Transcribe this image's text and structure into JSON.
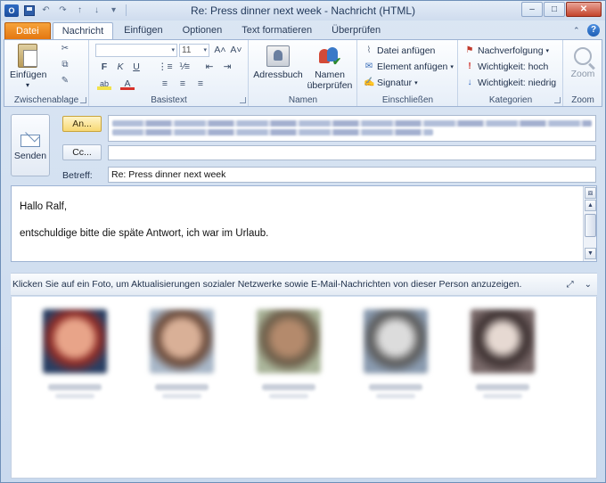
{
  "window": {
    "title": "Re: Press dinner next week - Nachricht (HTML)",
    "app_icon_letter": "O",
    "controls": {
      "minimize": "–",
      "maximize": "□",
      "close": "✕"
    }
  },
  "quick_access": {
    "undo": "↶",
    "redo": "↷",
    "up": "↑",
    "down": "↓",
    "customize": "▾"
  },
  "tabs": [
    {
      "label": "Datei"
    },
    {
      "label": "Nachricht"
    },
    {
      "label": "Einfügen"
    },
    {
      "label": "Optionen"
    },
    {
      "label": "Text formatieren"
    },
    {
      "label": "Überprüfen"
    }
  ],
  "help": {
    "caret": "⌃",
    "help": "?"
  },
  "ribbon": {
    "clipboard": {
      "label": "Zwischenablage",
      "paste": "Einfügen",
      "paste_arrow": "▾",
      "cut_icon": "✂",
      "copy_icon": "⧉",
      "painter_icon": "✎"
    },
    "basictext": {
      "label": "Basistext",
      "font_value": "",
      "size_value": "11",
      "grow": "A˄",
      "shrink": "A˅",
      "bold": "F",
      "italic": "K",
      "underline": "U",
      "highlight": "ab",
      "fontcolor": "A",
      "dd": "▾"
    },
    "names": {
      "label": "Namen",
      "address_book": "Adressbuch",
      "check_names_1": "Namen",
      "check_names_2": "überprüfen"
    },
    "include": {
      "label": "Einschließen",
      "attach_file": "Datei anfügen",
      "attach_item": "Element anfügen",
      "signature": "Signatur"
    },
    "tags": {
      "label": "Kategorien",
      "followup": "Nachverfolgung",
      "high": "Wichtigkeit: hoch",
      "low": "Wichtigkeit: niedrig"
    },
    "zoom": {
      "label": "Zoom",
      "button": "Zoom"
    }
  },
  "compose": {
    "send": "Senden",
    "to_button": "An...",
    "cc_button": "Cc...",
    "subject_label": "Betreff:",
    "subject_value": "Re: Press dinner next week"
  },
  "body": {
    "greeting": "Hallo Ralf,",
    "line1": "entschuldige bitte die späte Antwort, ich war im Urlaub."
  },
  "people_pane": {
    "hint": "Klicken Sie auf ein Foto, um Aktualisierungen sozialer Netzwerke sowie E-Mail-Nachrichten von dieser Person anzuzeigen.",
    "expand": "⤢",
    "collapse": "⌄"
  },
  "scrollbar": {
    "up": "▲",
    "down": "▼"
  },
  "colors": {
    "file_tab": "#e2740e",
    "to_button": "#f7d873",
    "accent": "#2e6bc4",
    "flag": "#c0392b",
    "importance_high": "#d0302a",
    "importance_low": "#2a62c0"
  }
}
